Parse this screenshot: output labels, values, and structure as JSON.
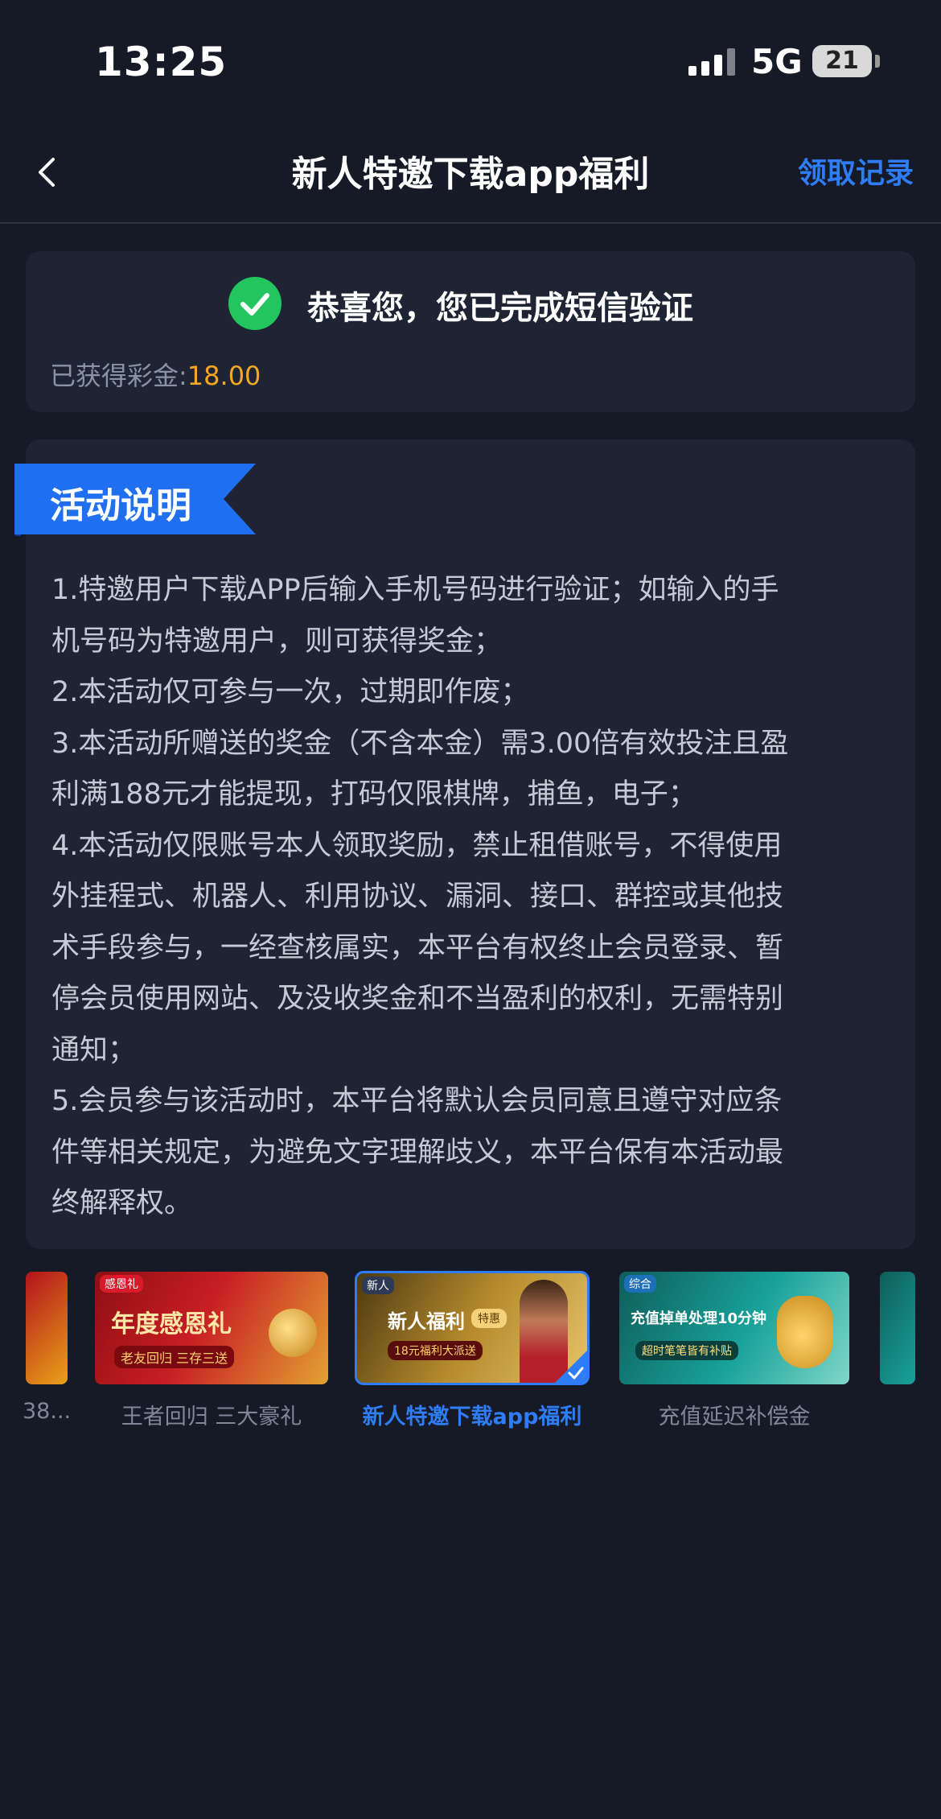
{
  "status_bar": {
    "time": "13:25",
    "network": "5G",
    "battery": "21"
  },
  "header": {
    "title": "新人特邀下载app福利",
    "record_link": "领取记录"
  },
  "success": {
    "message": "恭喜您，您已完成短信验证",
    "earned_label": "已获得彩金:",
    "earned_amount": "18.00"
  },
  "activity": {
    "heading": "活动说明",
    "lines": [
      "1.特邀用户下载APP后输入手机号码进行验证；如输入的手",
      "机号码为特邀用户，则可获得奖金；",
      "2.本活动仅可参与一次，过期即作废；",
      "3.本活动所赠送的奖金（不含本金）需3.00倍有效投注且盈",
      "利满188元才能提现，打码仅限棋牌，捕鱼，电子；",
      "4.本活动仅限账号本人领取奖励，禁止租借账号，不得使用",
      "外挂程式、机器人、利用协议、漏洞、接口、群控或其他技",
      "术手段参与，一经查核属实，本平台有权终止会员登录、暂",
      "停会员使用网站、及没收奖金和不当盈利的权利，无需特别",
      "通知；",
      "5.会员参与该活动时，本平台将默认会员同意且遵守对应条",
      "件等相关规定，为避免文字理解歧义，本平台保有本活动最",
      "终解释权。"
    ]
  },
  "promos": [
    {
      "label": "38...",
      "banner": ""
    },
    {
      "label": "王者回归 三大豪礼",
      "tag": "感恩礼",
      "banner": "年度感恩礼",
      "sub": "老友回归 三存三送"
    },
    {
      "label": "新人特邀下载app福利",
      "tag": "新人",
      "banner": "新人福利",
      "badge": "特惠",
      "sub": "18元福利大派送"
    },
    {
      "label": "充值延迟补偿金",
      "tag": "综合",
      "banner": "充值掉单处理10分钟",
      "sub": "超时笔笔皆有补贴"
    },
    {
      "label": "",
      "banner": ""
    }
  ],
  "colors": {
    "accent": "#2e7cf6",
    "gold": "#f5a623",
    "success": "#22c55e",
    "card": "#1e2433",
    "bg": "#151a26"
  }
}
